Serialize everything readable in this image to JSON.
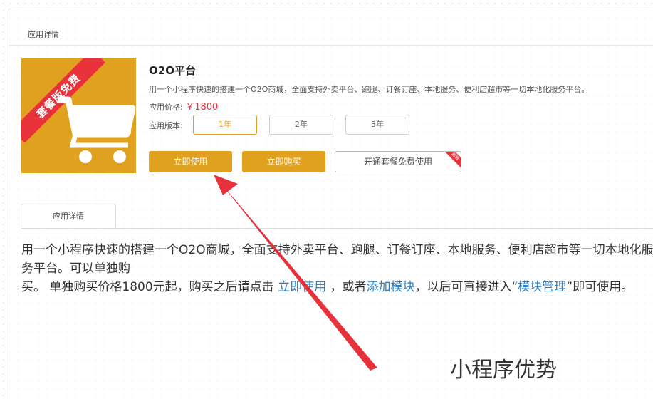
{
  "panel": {
    "title": "应用详情"
  },
  "product": {
    "ribbon": "套餐版免费",
    "image_icon": "shopping-cart-icon",
    "title": "O2O平台",
    "description": "用一个小程序快速的搭建一个O2O商城，全面支持外卖平台、跑腿、订餐订座、本地服务、便利店超市等一切本地化服务平台。",
    "price_label": "应用价格:",
    "price_value": "￥1800",
    "version_label": "应用版本:",
    "versions": [
      "1年",
      "2年",
      "3年"
    ],
    "selected_version": "1年",
    "buttons": {
      "use": "立即使用",
      "buy": "立即购买",
      "bundle": "开通套餐免费使用",
      "bundle_badge": "超值"
    }
  },
  "tabs": [
    {
      "label": "应用详情"
    }
  ],
  "detail": {
    "part1": "用一个小程序快速的搭建一个O2O商城，全面支持外卖平台、跑腿、订餐订座、本地服务、便利店超市等一切本地化服务平台。可以单独购",
    "part2": "买。 单独购买价格1800元起，购买之后请点击 ",
    "link1": "立即使用",
    "part3": " ，或者",
    "link2": "添加模块",
    "part4": "，以后可直接进入“",
    "link3": "模块管理",
    "part5": "”即可使用。"
  },
  "annotation": {
    "caption": "小程序优势",
    "arrow_color": "#e8323b"
  },
  "colors": {
    "accent": "#e0a21e",
    "ribbon": "#e8323b",
    "link": "#2d7fc1"
  }
}
